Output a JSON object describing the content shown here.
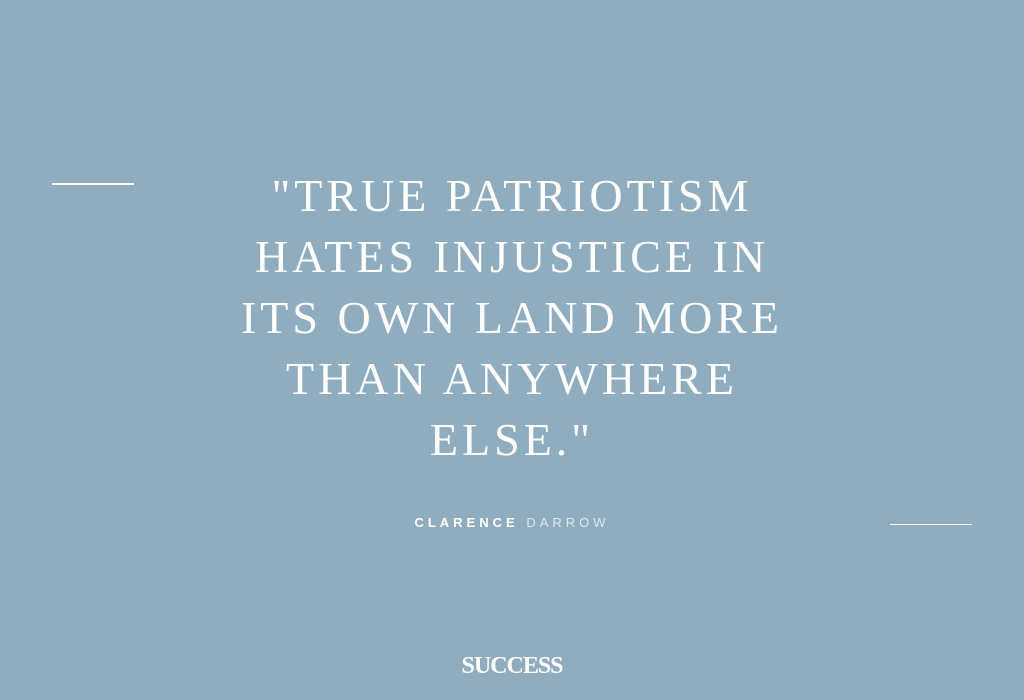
{
  "quote": {
    "lines": [
      "\"TRUE PATRIOTISM",
      "HATES INJUSTICE IN",
      "ITS OWN LAND MORE",
      "THAN ANYWHERE",
      "ELSE.\""
    ]
  },
  "attribution": {
    "first_name": "CLARENCE",
    "last_name": "DARROW"
  },
  "brand": {
    "logo_text": "SUCCESS"
  },
  "colors": {
    "background": "#90adbf",
    "text": "#ffffff"
  }
}
